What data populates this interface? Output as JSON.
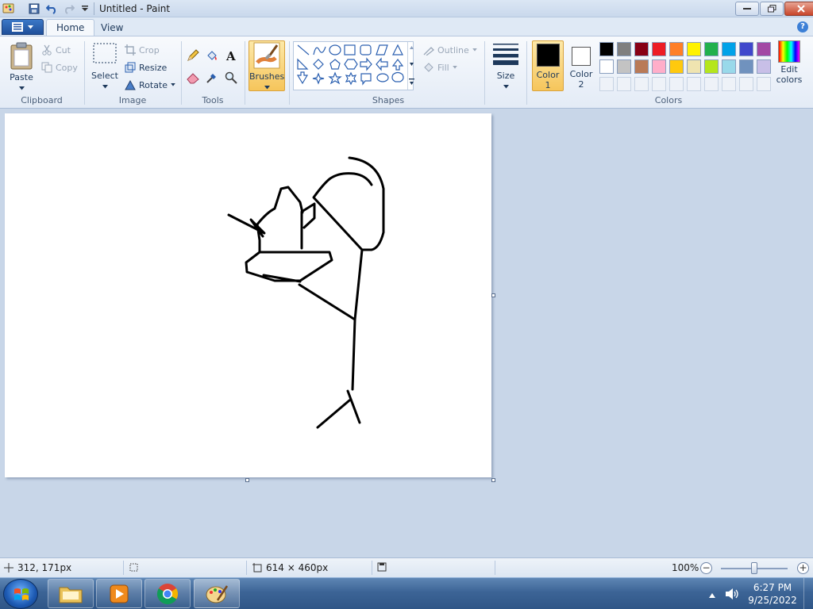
{
  "window": {
    "title": "Untitled - Paint"
  },
  "tabs": {
    "home": "Home",
    "view": "View"
  },
  "clipboard": {
    "paste": "Paste",
    "cut": "Cut",
    "copy": "Copy",
    "group": "Clipboard"
  },
  "image": {
    "select": "Select",
    "crop": "Crop",
    "resize": "Resize",
    "rotate": "Rotate",
    "group": "Image"
  },
  "tools": {
    "group": "Tools"
  },
  "brushes": {
    "label": "Brushes"
  },
  "shapes": {
    "outline": "Outline",
    "fill": "Fill",
    "group": "Shapes"
  },
  "size": {
    "label": "Size"
  },
  "colors": {
    "color1_line1": "Color",
    "color1_line2": "1",
    "color2_line1": "Color",
    "color2_line2": "2",
    "edit_line1": "Edit",
    "edit_line2": "colors",
    "group": "Colors",
    "color1_value": "#000000",
    "color2_value": "#ffffff",
    "palette_row1": [
      "#000000",
      "#7f7f7f",
      "#880015",
      "#ed1c24",
      "#ff7f27",
      "#fff200",
      "#22b14c",
      "#00a2e8",
      "#3f48cc",
      "#a349a4"
    ],
    "palette_row2": [
      "#ffffff",
      "#c3c3c3",
      "#b97a57",
      "#ffaec9",
      "#ffc90e",
      "#efe4b0",
      "#b5e61d",
      "#99d9ea",
      "#7092be",
      "#c8bfe7"
    ]
  },
  "status": {
    "cursor_pos": "312, 171px",
    "canvas_size": "614 × 460px",
    "zoom": "100%",
    "zoom_percent": 100
  },
  "taskbar": {
    "time": "6:27 PM",
    "date": "9/25/2022"
  }
}
